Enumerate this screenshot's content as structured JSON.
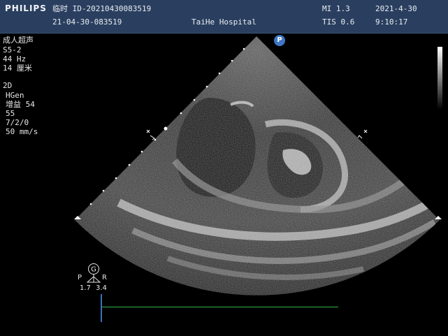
{
  "header": {
    "brand": "PHILIPS",
    "patient_id": "临时 ID-20210430083519",
    "exam_id": "21-04-30-083519",
    "hospital": "TaiHe Hospital",
    "mi": "MI 1.3",
    "tis": "TIS 0.6",
    "date": "2021-4-30",
    "time": "9:10:17"
  },
  "left_panel": {
    "mode": "成人超声",
    "probe": "S5-2",
    "frame_rate": "44 Hz",
    "depth": "14 厘米",
    "section": "2D",
    "harmonic": "HGen",
    "gain": "增益 54",
    "compression": "55",
    "persistence": "7/2/0",
    "sweep_speed": "50 mm/s"
  },
  "orientation_marker": "P",
  "orientation_icon": {
    "g_label": "G",
    "p_label": "P",
    "r_label": "R",
    "value_left": "1.7",
    "value_right": "3.4"
  },
  "colors": {
    "header_bg": "#2a3f5f",
    "marker_blue": "#3f77c4",
    "mmode_line": "#2fb64a",
    "depth_line": "#3f6fb6"
  }
}
